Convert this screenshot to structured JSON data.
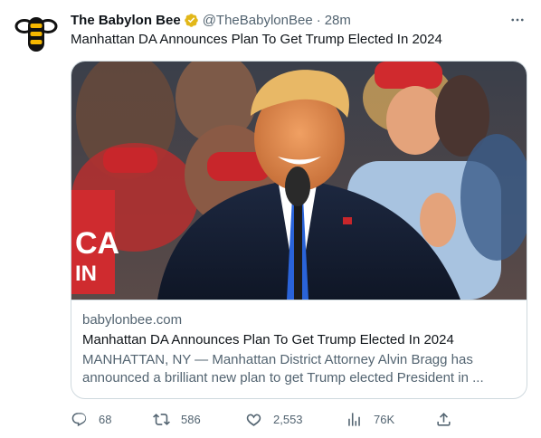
{
  "author": {
    "name": "The Babylon Bee",
    "handle": "@TheBabylonBee",
    "separator": "·",
    "time": "28m",
    "verified_color": "#e2b719",
    "avatar_icon": "bee-logo-icon"
  },
  "tweet": {
    "text": "Manhattan DA Announces Plan To Get Trump Elected In 2024"
  },
  "card": {
    "domain": "babylonbee.com",
    "title": "Manhattan DA Announces Plan To Get Trump Elected In 2024",
    "description": "MANHATTAN, NY — Manhattan District Attorney Alvin Bragg has announced a brilliant new plan to get Trump elected President in ...",
    "image_alt": "Donald Trump smiling at a microphone in front of a rally crowd wearing red hats",
    "sign_text": "CA IN"
  },
  "actions": {
    "reply_count": "68",
    "retweet_count": "586",
    "like_count": "2,553",
    "views_count": "76K"
  },
  "colors": {
    "text_primary": "#0f1419",
    "text_secondary": "#536471",
    "border": "#cfd9de",
    "bee_yellow": "#f5b700"
  }
}
